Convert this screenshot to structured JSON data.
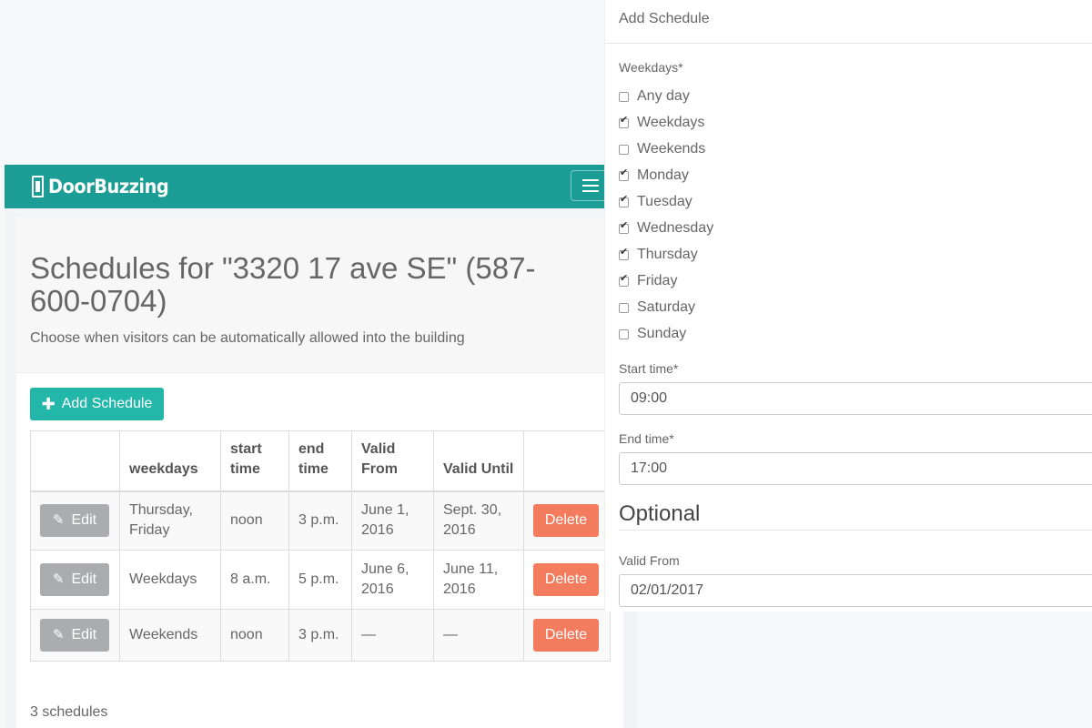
{
  "brand": {
    "name": "DoorBuzzing"
  },
  "header": {
    "title": "Schedules for \"3320 17 ave SE\" (587-600-0704)",
    "subtitle": "Choose when visitors can be automatically allowed into the building"
  },
  "toolbar": {
    "add_label": "Add Schedule"
  },
  "table": {
    "columns": [
      "",
      "weekdays",
      "start time",
      "end time",
      "Valid From",
      "Valid Until",
      ""
    ],
    "rows": [
      {
        "edit": "Edit",
        "weekdays": "Thursday, Friday",
        "start": "noon",
        "end": "3 p.m.",
        "valid_from": "June 1, 2016",
        "valid_until": "Sept. 30, 2016",
        "delete": "Delete"
      },
      {
        "edit": "Edit",
        "weekdays": "Weekdays",
        "start": "8 a.m.",
        "end": "5 p.m.",
        "valid_from": "June 6, 2016",
        "valid_until": "June 11, 2016",
        "delete": "Delete"
      },
      {
        "edit": "Edit",
        "weekdays": "Weekends",
        "start": "noon",
        "end": "3 p.m.",
        "valid_from": "—",
        "valid_until": "—",
        "delete": "Delete"
      }
    ]
  },
  "footer": {
    "count": "3 schedules"
  },
  "modal": {
    "title": "Add Schedule",
    "weekdays_label": "Weekdays*",
    "options": [
      {
        "label": "Any day",
        "checked": false
      },
      {
        "label": "Weekdays",
        "checked": true
      },
      {
        "label": "Weekends",
        "checked": false
      },
      {
        "label": "Monday",
        "checked": true
      },
      {
        "label": "Tuesday",
        "checked": true
      },
      {
        "label": "Wednesday",
        "checked": true
      },
      {
        "label": "Thursday",
        "checked": true
      },
      {
        "label": "Friday",
        "checked": true
      },
      {
        "label": "Saturday",
        "checked": false
      },
      {
        "label": "Sunday",
        "checked": false
      }
    ],
    "start_label": "Start time*",
    "start_value": "09:00",
    "end_label": "End time*",
    "end_value": "17:00",
    "optional_title": "Optional",
    "valid_from_label": "Valid From",
    "valid_from_value": "02/01/2017"
  },
  "colors": {
    "brand": "#1b9c94",
    "accent": "#23b7aa",
    "danger": "#f47c5e",
    "muted_button": "#aaacae"
  }
}
